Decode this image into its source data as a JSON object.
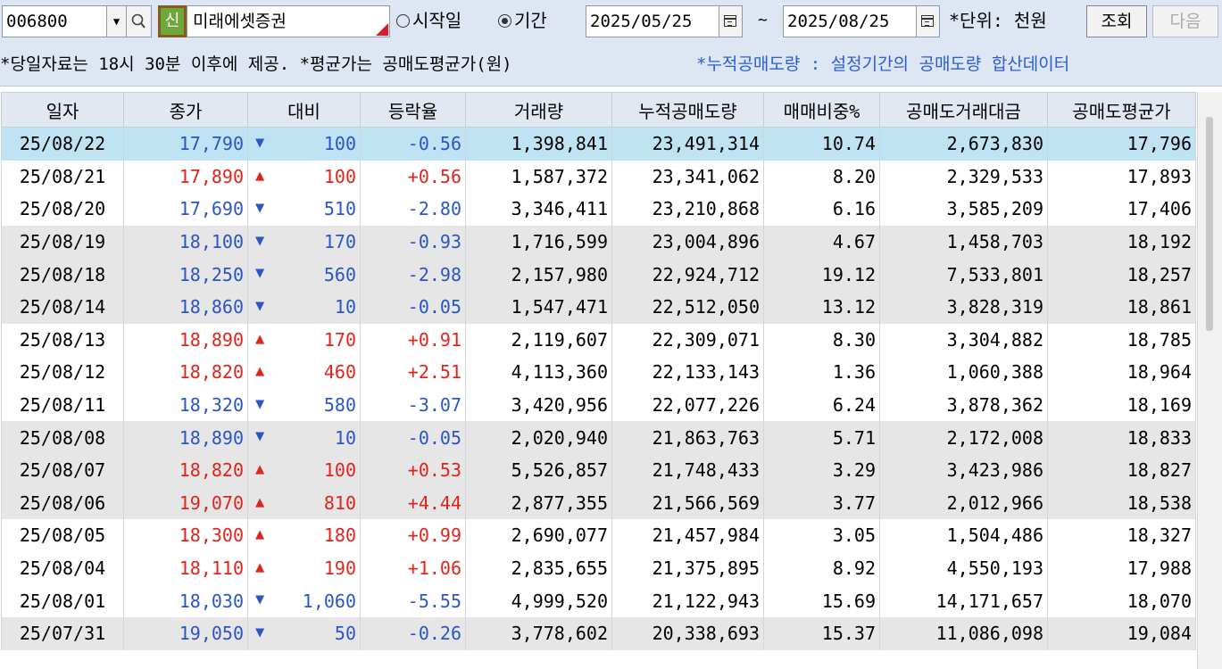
{
  "toolbar": {
    "code": "006800",
    "new_badge": "신",
    "stock_name": "미래에셋증권",
    "radio_start": "시작일",
    "radio_period": "기간",
    "date_from": "2025/05/25",
    "tilde": "~",
    "date_to": "2025/08/25",
    "unit_label": "*단위: 천원",
    "query_button": "조회",
    "next_button": "다음"
  },
  "info": {
    "note1": "*당일자료는 18시 30분 이후에 제공. *평균가는 공매도평균가(원)",
    "note2": "*누적공매도량 : 설정기간의 공매도량 합산데이터"
  },
  "colors": {
    "up": "#e0241c",
    "down": "#2a56c8",
    "selected_row": "#bfe3f2",
    "gray_week": "#e6e6e6"
  },
  "table": {
    "headers": [
      "일자",
      "종가",
      "대비",
      "등락율",
      "거래량",
      "누적공매도량",
      "매매비중%",
      "공매도거래대금",
      "공매도평균가"
    ],
    "rows": [
      {
        "date": "25/08/22",
        "close": "17,790",
        "dir": "down",
        "chg": "100",
        "rate": "-0.56",
        "vol": "1,398,841",
        "cum": "23,491,314",
        "ratio": "10.74",
        "amt": "2,673,830",
        "avg": "17,796"
      },
      {
        "date": "25/08/21",
        "close": "17,890",
        "dir": "up",
        "chg": "100",
        "rate": "+0.56",
        "vol": "1,587,372",
        "cum": "23,341,062",
        "ratio": "8.20",
        "amt": "2,329,533",
        "avg": "17,893"
      },
      {
        "date": "25/08/20",
        "close": "17,690",
        "dir": "down",
        "chg": "510",
        "rate": "-2.80",
        "vol": "3,346,411",
        "cum": "23,210,868",
        "ratio": "6.16",
        "amt": "3,585,209",
        "avg": "17,406"
      },
      {
        "date": "25/08/19",
        "close": "18,100",
        "dir": "down",
        "chg": "170",
        "rate": "-0.93",
        "vol": "1,716,599",
        "cum": "23,004,896",
        "ratio": "4.67",
        "amt": "1,458,703",
        "avg": "18,192"
      },
      {
        "date": "25/08/18",
        "close": "18,250",
        "dir": "down",
        "chg": "560",
        "rate": "-2.98",
        "vol": "2,157,980",
        "cum": "22,924,712",
        "ratio": "19.12",
        "amt": "7,533,801",
        "avg": "18,257"
      },
      {
        "date": "25/08/14",
        "close": "18,860",
        "dir": "down",
        "chg": "10",
        "rate": "-0.05",
        "vol": "1,547,471",
        "cum": "22,512,050",
        "ratio": "13.12",
        "amt": "3,828,319",
        "avg": "18,861"
      },
      {
        "date": "25/08/13",
        "close": "18,890",
        "dir": "up",
        "chg": "170",
        "rate": "+0.91",
        "vol": "2,119,607",
        "cum": "22,309,071",
        "ratio": "8.30",
        "amt": "3,304,882",
        "avg": "18,785"
      },
      {
        "date": "25/08/12",
        "close": "18,820",
        "dir": "up",
        "chg": "460",
        "rate": "+2.51",
        "vol": "4,113,360",
        "cum": "22,133,143",
        "ratio": "1.36",
        "amt": "1,060,388",
        "avg": "18,964"
      },
      {
        "date": "25/08/11",
        "close": "18,320",
        "dir": "down",
        "chg": "580",
        "rate": "-3.07",
        "vol": "3,420,956",
        "cum": "22,077,226",
        "ratio": "6.24",
        "amt": "3,878,362",
        "avg": "18,169"
      },
      {
        "date": "25/08/08",
        "close": "18,890",
        "dir": "down",
        "chg": "10",
        "rate": "-0.05",
        "vol": "2,020,940",
        "cum": "21,863,763",
        "ratio": "5.71",
        "amt": "2,172,008",
        "avg": "18,833"
      },
      {
        "date": "25/08/07",
        "close": "18,820",
        "dir": "up",
        "chg": "100",
        "rate": "+0.53",
        "vol": "5,526,857",
        "cum": "21,748,433",
        "ratio": "3.29",
        "amt": "3,423,986",
        "avg": "18,827"
      },
      {
        "date": "25/08/06",
        "close": "19,070",
        "dir": "up",
        "chg": "810",
        "rate": "+4.44",
        "vol": "2,877,355",
        "cum": "21,566,569",
        "ratio": "3.77",
        "amt": "2,012,966",
        "avg": "18,538"
      },
      {
        "date": "25/08/05",
        "close": "18,300",
        "dir": "up",
        "chg": "180",
        "rate": "+0.99",
        "vol": "2,690,077",
        "cum": "21,457,984",
        "ratio": "3.05",
        "amt": "1,504,486",
        "avg": "18,327"
      },
      {
        "date": "25/08/04",
        "close": "18,110",
        "dir": "up",
        "chg": "190",
        "rate": "+1.06",
        "vol": "2,835,655",
        "cum": "21,375,895",
        "ratio": "8.92",
        "amt": "4,550,193",
        "avg": "17,988"
      },
      {
        "date": "25/08/01",
        "close": "18,030",
        "dir": "down",
        "chg": "1,060",
        "rate": "-5.55",
        "vol": "4,999,520",
        "cum": "21,122,943",
        "ratio": "15.69",
        "amt": "14,171,657",
        "avg": "18,070"
      },
      {
        "date": "25/07/31",
        "close": "19,050",
        "dir": "down",
        "chg": "50",
        "rate": "-0.26",
        "vol": "3,778,602",
        "cum": "20,338,693",
        "ratio": "15.37",
        "amt": "11,086,098",
        "avg": "19,084"
      }
    ]
  }
}
